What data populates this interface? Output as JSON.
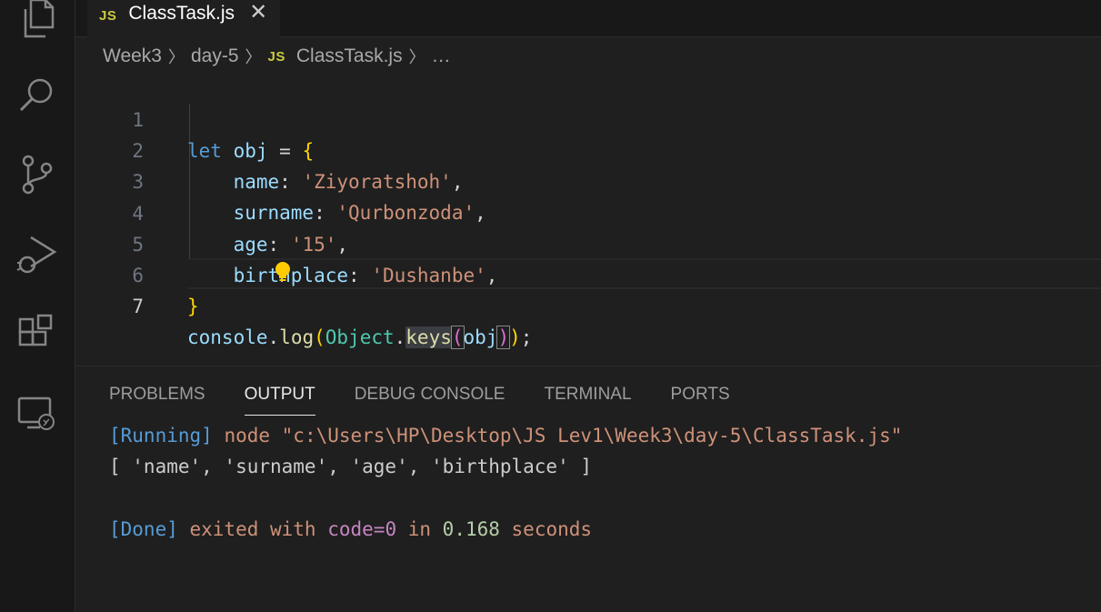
{
  "activity_bar": {
    "icons": [
      "files-icon",
      "search-icon",
      "source-control-icon",
      "run-debug-icon",
      "extensions-icon",
      "remote-explorer-icon"
    ]
  },
  "tab": {
    "badge": "JS",
    "title": "ClassTask.js",
    "close": "✕"
  },
  "breadcrumb": {
    "items": [
      "Week3",
      "day-5"
    ],
    "badge": "JS",
    "file": "ClassTask.js",
    "more": "…"
  },
  "editor": {
    "line_numbers": [
      "1",
      "2",
      "3",
      "4",
      "5",
      "6",
      "7"
    ],
    "active_line": "7",
    "lines": {
      "l1": {
        "kw": "let",
        "name": "obj",
        "op": " = ",
        "brace": "{"
      },
      "l2": {
        "key": "name",
        "colon": ": ",
        "val": "'Ziyoratshoh'",
        "comma": ","
      },
      "l3": {
        "key": "surname",
        "colon": ": ",
        "val": "'Qurbonzoda'",
        "comma": ","
      },
      "l4": {
        "key": "age",
        "colon": ": ",
        "val": "'15'",
        "comma": ","
      },
      "l5": {
        "key": "birthplace",
        "colon": ": ",
        "val": "'Dushanbe'",
        "comma": ","
      },
      "l6": {
        "brace": "}"
      },
      "l7": {
        "obj": "console",
        "dot1": ".",
        "fn1": "log",
        "p1": "(",
        "cls": "Object",
        "dot2": ".",
        "fn2": "keys",
        "p2": "(",
        "arg": "obj",
        "p3": ")",
        "p4": ")",
        "semi": ";"
      }
    }
  },
  "panel": {
    "tabs": [
      "PROBLEMS",
      "OUTPUT",
      "DEBUG CONSOLE",
      "TERMINAL",
      "PORTS"
    ],
    "active_tab": "OUTPUT",
    "output": {
      "run_tag": "[Running]",
      "run_cmd": " node \"c:\\Users\\HP\\Desktop\\JS Lev1\\Week3\\day-5\\ClassTask.js\"",
      "result": "[ 'name', 'surname', 'age', 'birthplace' ]",
      "done_tag": "[Done]",
      "done_1": " exited with ",
      "done_code": "code=0",
      "done_2": " in ",
      "done_time": "0.168",
      "done_3": " seconds"
    }
  },
  "colors": {
    "accent": "#569cd6",
    "string": "#ce9178",
    "bracket_gold": "#ffd700",
    "bulb": "#ffcc00"
  }
}
